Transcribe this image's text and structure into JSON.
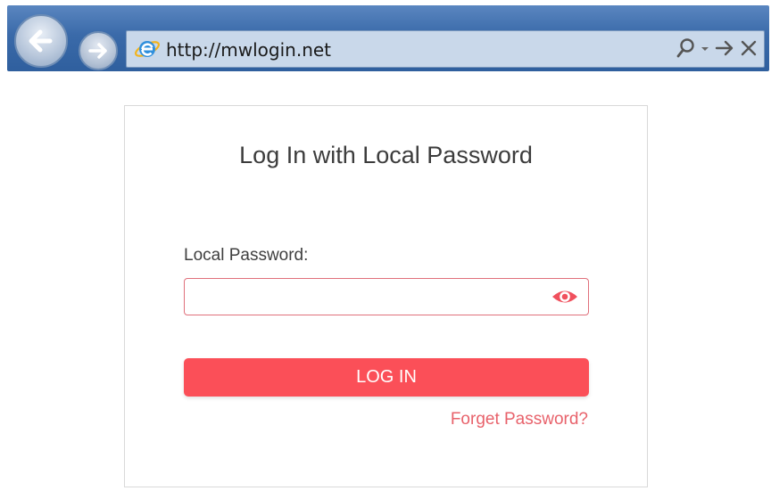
{
  "browser": {
    "url": "http://mwlogin.net",
    "back_icon": "back-arrow-icon",
    "forward_icon": "forward-arrow-icon",
    "site_icon": "ie-logo-icon",
    "search_icon": "search-icon",
    "dropdown_icon": "chevron-down-icon",
    "go_icon": "go-arrow-icon",
    "stop_icon": "close-icon"
  },
  "login": {
    "title": "Log In with Local Password",
    "password_label": "Local Password:",
    "password_value": "",
    "password_placeholder": "",
    "reveal_icon": "eye-icon",
    "login_button": "LOG IN",
    "forget_link": "Forget Password?"
  },
  "colors": {
    "accent": "#fb4f58",
    "link": "#e8626b",
    "field_border": "#e0707b",
    "toolbar": "#3a6aa9"
  }
}
